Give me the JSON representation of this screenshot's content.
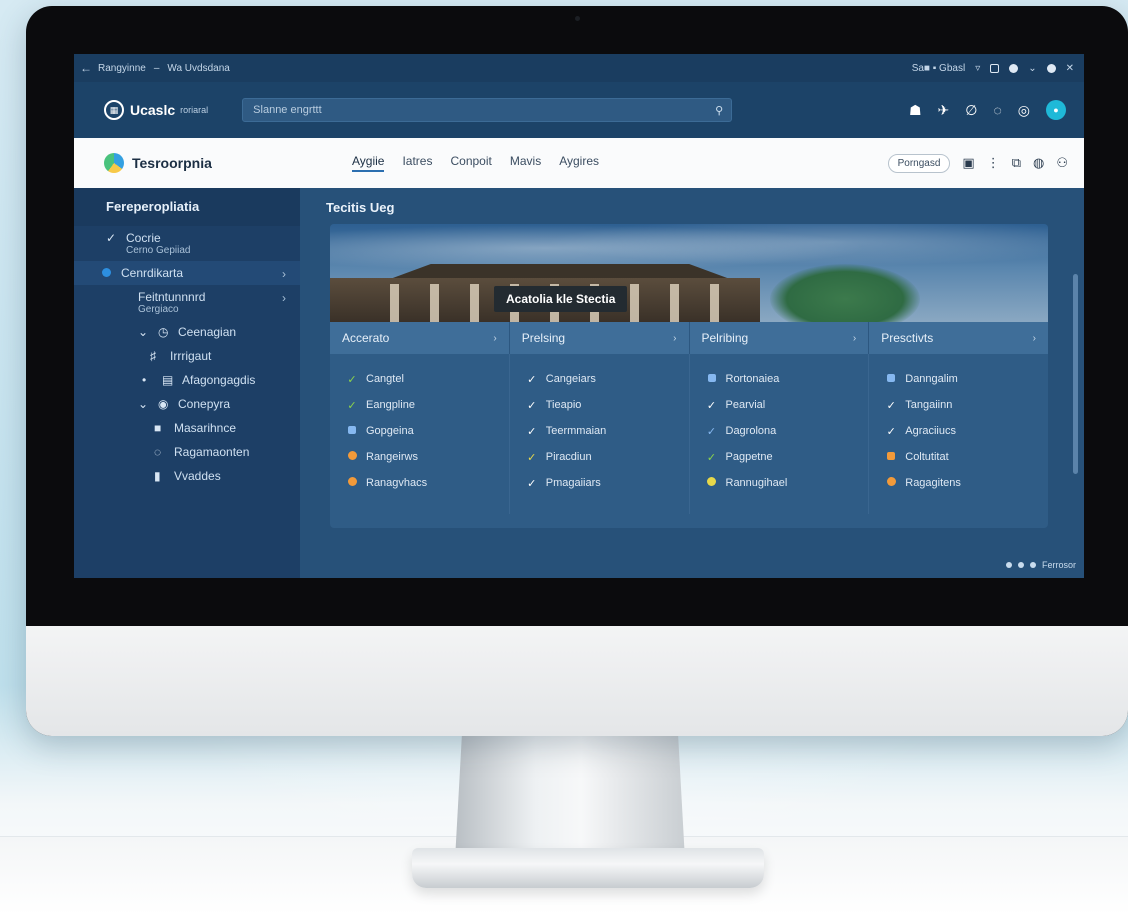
{
  "browser": {
    "back_glyph": "←",
    "crumb_1": "Rangyinne",
    "crumb_sep": "–",
    "crumb_2": "Wa Uvdsdana",
    "status_text": "Sa■ ▪ Gbasl"
  },
  "header": {
    "logo_name": "Ucaslc",
    "logo_tag": "roriaral",
    "search_placeholder": "Slanne engrttt"
  },
  "nav": {
    "brand": "Tesroorpnia",
    "tabs": [
      "Aygiie",
      "Iatres",
      "Conpoit",
      "Mavis",
      "Aygires"
    ],
    "button_label": "Porngasd"
  },
  "sidebar": {
    "title": "Fereperopliatia",
    "items": [
      {
        "label": "Cocrie",
        "sub": "Cerno Gepiiad"
      },
      {
        "label": "Cenrdikarta"
      },
      {
        "label": "Feitntunnnrd",
        "sub": "Gergiaco"
      },
      {
        "label": "Ceenagian"
      },
      {
        "label": "Irrrigaut"
      },
      {
        "label": "Afagongagdis"
      },
      {
        "label": "Conepyra"
      },
      {
        "label": "Masarihnce"
      },
      {
        "label": "Ragamaonten"
      },
      {
        "label": "Vvaddes"
      }
    ]
  },
  "main": {
    "title": "Tecitis Ueg",
    "hero_label": "Acatolia kle Stectia",
    "columns": [
      {
        "head": "Accerato",
        "items": [
          "Cangtel",
          "Eangpline",
          "Gopgeina",
          "Rangeirws",
          "Ranagvhacs"
        ]
      },
      {
        "head": "Prelsing",
        "items": [
          "Cangeiars",
          "Tieapio",
          "Teermmaian",
          "Piracdiun",
          "Pmagaiiars"
        ]
      },
      {
        "head": "Pelribing",
        "items": [
          "Rortonaiea",
          "Pearvial",
          "Dagrolona",
          "Pagpetne",
          "Rannugihael"
        ]
      },
      {
        "head": "Presctivts",
        "items": [
          "Danngalim",
          "Tangaiinn",
          "Agraciiucs",
          "Coltutitat",
          "Ragagitens"
        ]
      }
    ]
  },
  "footer": {
    "status": "Ferrosor"
  },
  "colors": {
    "screen_bg": "#1f4870",
    "accent": "#1fb9d8",
    "check_green": "#8bd44a",
    "check_white": "#ffffff",
    "square_blue": "#86b8f0",
    "orange": "#f29a3a",
    "yellow": "#e7d84a"
  }
}
